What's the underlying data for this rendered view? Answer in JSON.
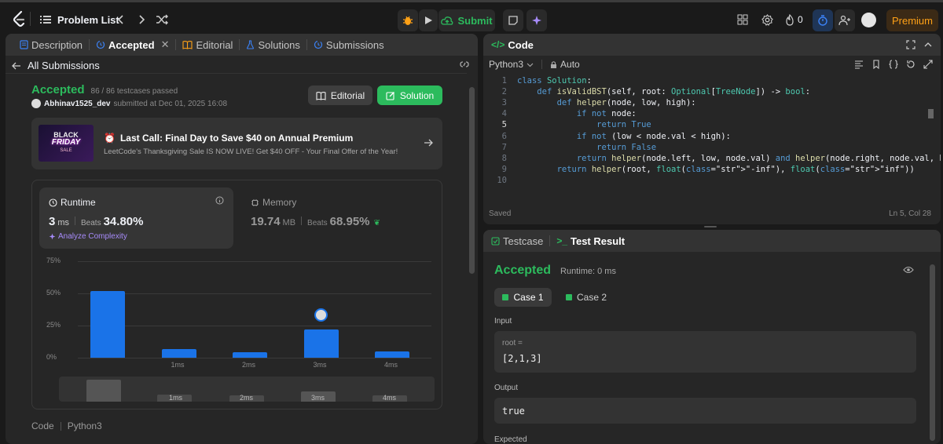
{
  "topbar": {
    "problem_list": "Problem List",
    "submit": "Submit",
    "streak": "0",
    "premium": "Premium"
  },
  "left": {
    "tabs": [
      {
        "label": "Description"
      },
      {
        "label": "Accepted"
      },
      {
        "label": "Editorial"
      },
      {
        "label": "Solutions"
      },
      {
        "label": "Submissions"
      }
    ],
    "back_label": "All Submissions",
    "status": "Accepted",
    "testcases": "86 / 86 testcases passed",
    "username": "Abhinav1525_dev",
    "submitted_at": "submitted at Dec 01, 2025 16:08",
    "editorial_btn": "Editorial",
    "solution_btn": "Solution",
    "promo": {
      "img_line1": "BLACK",
      "img_line2": "FRIDAY",
      "img_line3": "SALE",
      "title": "Last Call: Final Day to Save $40 on Annual Premium",
      "subtitle": "LeetCode's Thanksgiving Sale IS NOW LIVE! Get $40 OFF - Your Final Offer of the Year!"
    },
    "runtime": {
      "label": "Runtime",
      "value": "3",
      "unit": "ms",
      "beats_label": "Beats",
      "beats": "34.80%",
      "analyze": "Analyze Complexity"
    },
    "memory": {
      "label": "Memory",
      "value": "19.74",
      "unit": "MB",
      "beats_label": "Beats",
      "beats": "68.95%"
    },
    "code_label": "Code",
    "lang_label": "Python3"
  },
  "chart_data": {
    "type": "bar",
    "categories": [
      "",
      "1ms",
      "2ms",
      "3ms",
      "4ms"
    ],
    "values": [
      52,
      7,
      4,
      22,
      5
    ],
    "ytick_labels": [
      "75%",
      "50%",
      "25%",
      "0%"
    ],
    "ylim": [
      0,
      75
    ],
    "highlight_index": 3,
    "minimap_labels": [
      "1ms",
      "2ms",
      "3ms",
      "4ms"
    ]
  },
  "code": {
    "title": "Code",
    "lang": "Python3",
    "mode": "Auto",
    "saved": "Saved",
    "cursor": "Ln 5, Col 28",
    "lines": [
      "class Solution:",
      "    def isValidBST(self, root: Optional[TreeNode]) -> bool:",
      "        def helper(node, low, high):",
      "            if not node:",
      "                return True",
      "            if not (low < node.val < high):",
      "                return False",
      "            return helper(node.left, low, node.val) and helper(node.right, node.val, high)",
      "        return helper(root, float(\"-inf\"), float(\"inf\"))",
      ""
    ]
  },
  "test": {
    "tab_testcase": "Testcase",
    "tab_result": "Test Result",
    "status": "Accepted",
    "runtime": "Runtime: 0 ms",
    "case1": "Case 1",
    "case2": "Case 2",
    "input_label": "Input",
    "input_var": "root =",
    "input_value": "[2,1,3]",
    "output_label": "Output",
    "output_value": "true",
    "expected_label": "Expected"
  },
  "colors": {
    "accent_green": "#2cbb5d",
    "bar_blue": "#1a73e8",
    "premium": "#ffa116"
  }
}
